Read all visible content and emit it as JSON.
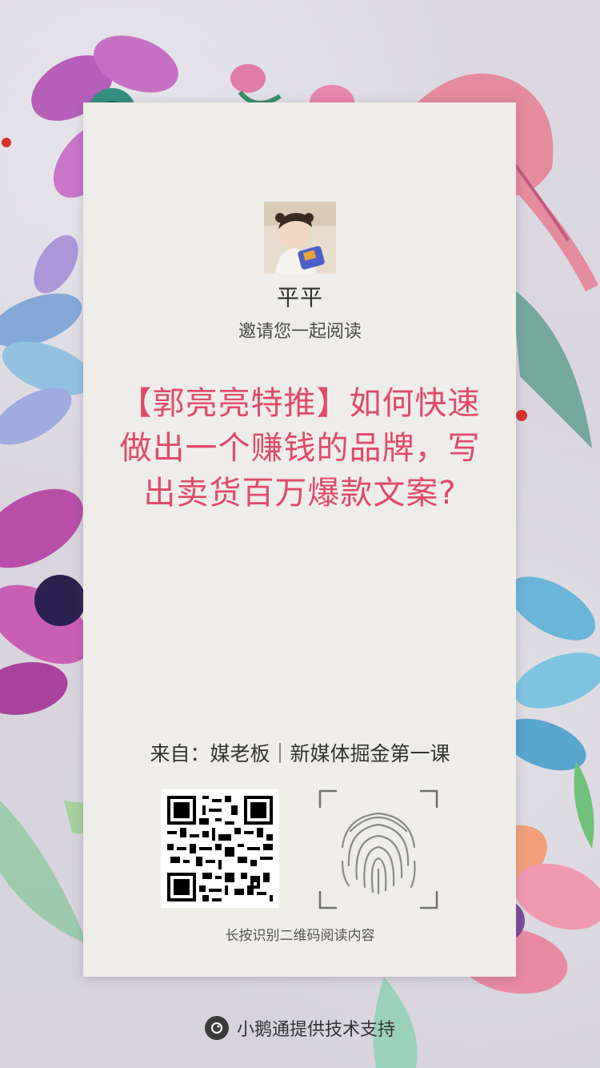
{
  "inviter": {
    "name": "平平",
    "invite_text": "邀请您一起阅读"
  },
  "article": {
    "title": "【郭亮亮特推】如何快速做出一个赚钱的品牌，写出卖货百万爆款文案?"
  },
  "source": {
    "text": "来自：媒老板｜新媒体掘金第一课"
  },
  "qr": {
    "hint": "长按识别二维码阅读内容"
  },
  "footer": {
    "text": "小鹅通提供技术支持"
  },
  "colors": {
    "title": "#e04a6a",
    "card": "#efedea",
    "background": "#d9d6df"
  }
}
